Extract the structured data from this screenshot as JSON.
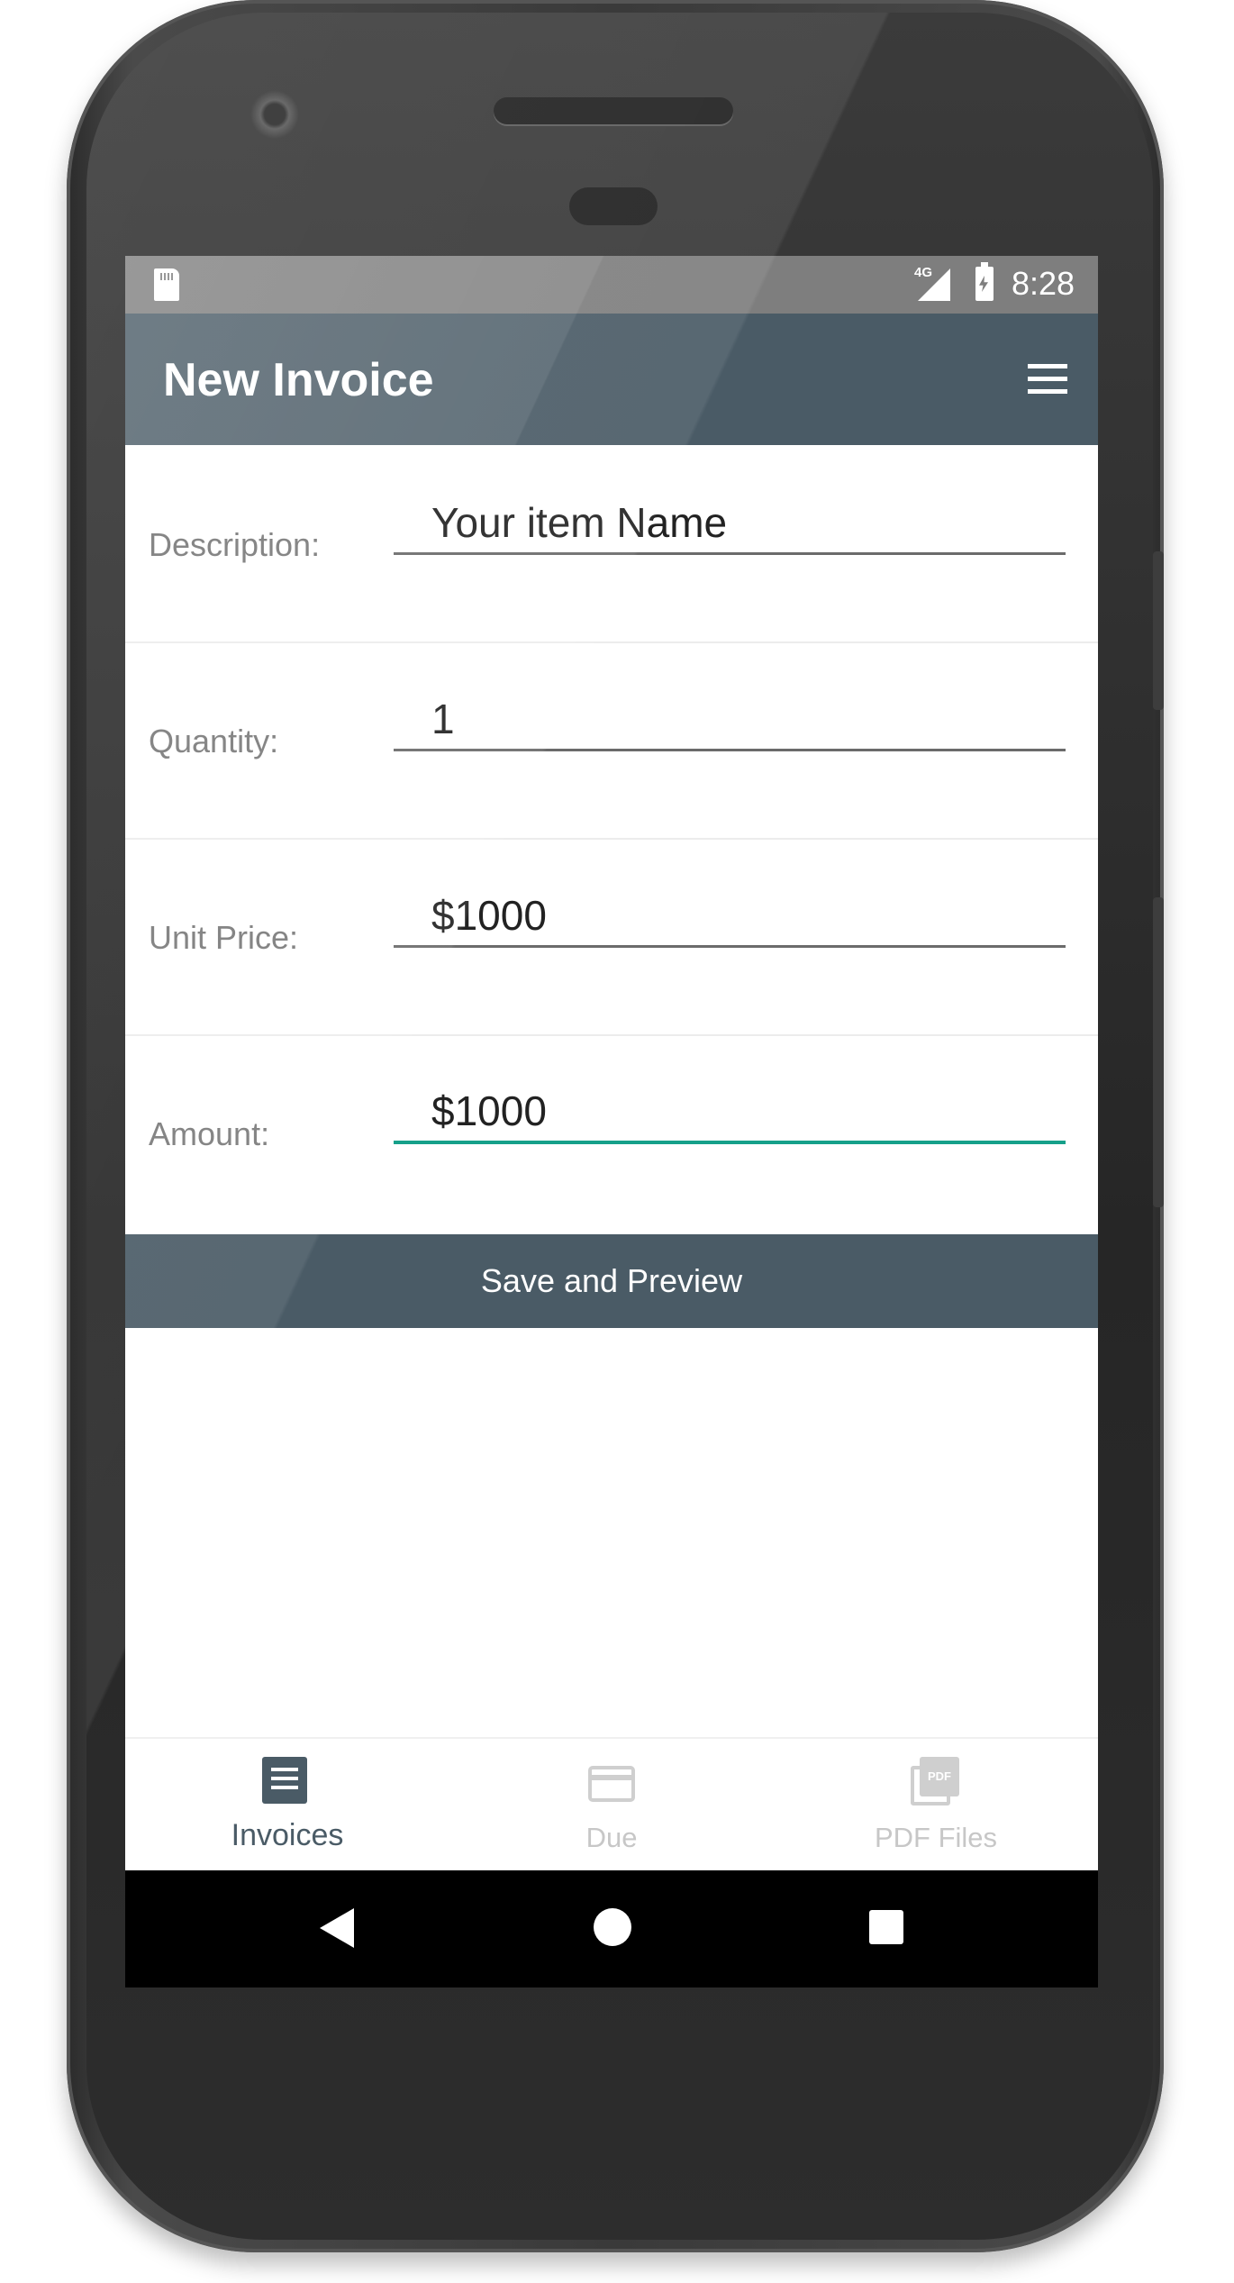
{
  "status_bar": {
    "network": "4G",
    "time": "8:28"
  },
  "app_bar": {
    "title": "New Invoice"
  },
  "form": {
    "rows": [
      {
        "label": "Description:",
        "value": "Your item Name"
      },
      {
        "label": "Quantity:",
        "value": "1"
      },
      {
        "label": "Unit Price:",
        "value": "$1000"
      },
      {
        "label": "Amount:",
        "value": "$1000"
      }
    ],
    "active_field_color": "#16a08a"
  },
  "save_button": {
    "label": "Save and Preview"
  },
  "bottom_nav": {
    "items": [
      {
        "label": "Invoices",
        "icon": "receipt-icon",
        "active": true
      },
      {
        "label": "Due",
        "icon": "credit-card-icon",
        "active": false
      },
      {
        "label": "PDF Files",
        "icon": "pdf-files-icon",
        "active": false
      }
    ],
    "pdf_badge": "PDF"
  },
  "theme": {
    "primary": "#4a5b66",
    "status_bar": "#7e7e7e"
  }
}
